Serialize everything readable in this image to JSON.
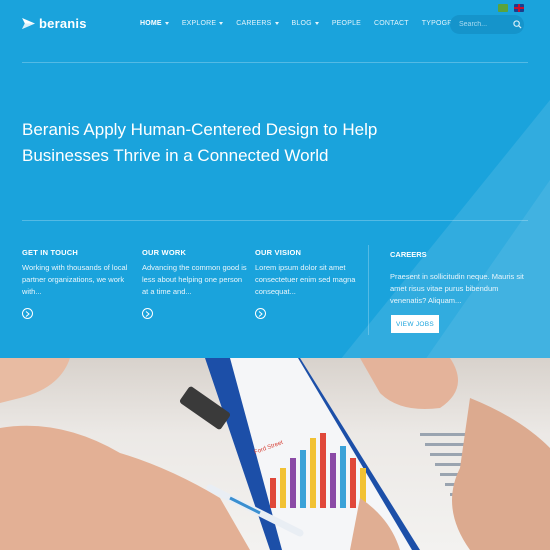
{
  "brand": {
    "name": "beranis"
  },
  "languages": [
    "arabic-flag",
    "english-flag"
  ],
  "nav": {
    "items": [
      {
        "label": "HOME",
        "dropdown": true,
        "active": true
      },
      {
        "label": "EXPLORE",
        "dropdown": true
      },
      {
        "label": "CAREERS",
        "dropdown": true
      },
      {
        "label": "BLOG",
        "dropdown": true
      },
      {
        "label": "PEOPLE",
        "dropdown": false
      },
      {
        "label": "CONTACT",
        "dropdown": false
      },
      {
        "label": "TYPOGRAPHY",
        "dropdown": true
      }
    ]
  },
  "search": {
    "placeholder": "Search..."
  },
  "hero": {
    "line1": "Beranis Apply Human-Centered Design to Help",
    "line2": "Businesses Thrive in a Connected World"
  },
  "columns": [
    {
      "title": "GET IN TOUCH",
      "text": "Working with thousands of local partner organizations, we work with..."
    },
    {
      "title": "OUR WORK",
      "text": "Advancing the common good is less about helping one person at a time and..."
    },
    {
      "title": "OUR VISION",
      "text": "Lorem ipsum dolor sit amet consectetuer enim sed magna consequat..."
    }
  ],
  "careers": {
    "title": "CAREERS",
    "text": "Praesent in sollicitudin neque. Mauris sit amet risus vitae purus bibendum venenatis? Aliquam...",
    "button": "VIEW JOBS"
  },
  "chart_label": "Ford Street",
  "colors": {
    "accent": "#1aa3dc",
    "white": "#ffffff"
  }
}
